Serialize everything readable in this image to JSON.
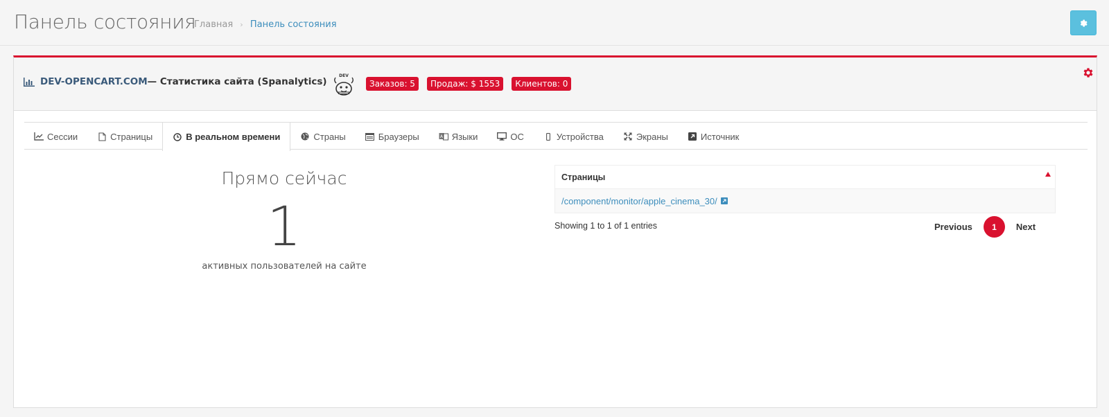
{
  "header": {
    "title": "Панель состояния",
    "breadcrumb": {
      "home": "Главная",
      "separator": "›",
      "current": "Панель состояния"
    }
  },
  "panel": {
    "site": "DEV-OPENCART.COM",
    "title_rest": " — Статистика сайта (Spanalytics)",
    "mascot_label": "DEV",
    "badges": [
      {
        "label": "Заказов: 5"
      },
      {
        "label": "Продаж: $ 1553"
      },
      {
        "label": "Клиентов: 0"
      }
    ]
  },
  "tabs": [
    {
      "label": "Сессии",
      "icon": "line-chart-icon"
    },
    {
      "label": "Страницы",
      "icon": "file-icon"
    },
    {
      "label": "В реальном времени",
      "icon": "clock-icon",
      "active": true
    },
    {
      "label": "Страны",
      "icon": "globe-icon"
    },
    {
      "label": "Браузеры",
      "icon": "browser-icon"
    },
    {
      "label": "Языки",
      "icon": "language-icon"
    },
    {
      "label": "ОС",
      "icon": "desktop-icon"
    },
    {
      "label": "Устройства",
      "icon": "mobile-icon"
    },
    {
      "label": "Экраны",
      "icon": "expand-icon"
    },
    {
      "label": "Источник",
      "icon": "external-link-icon"
    }
  ],
  "realtime": {
    "title": "Прямо сейчас",
    "count": "1",
    "caption": "активных пользователей на сайте"
  },
  "table": {
    "header": "Страницы",
    "rows": [
      {
        "url": "/component/monitor/apple_cinema_30/"
      }
    ],
    "info": "Showing 1 to 1 of 1 entries",
    "pagination": {
      "previous": "Previous",
      "current_page": "1",
      "next": "Next"
    }
  },
  "colors": {
    "accent": "#d9112f",
    "info_button": "#5bc0de",
    "link": "#3c8dbc"
  }
}
